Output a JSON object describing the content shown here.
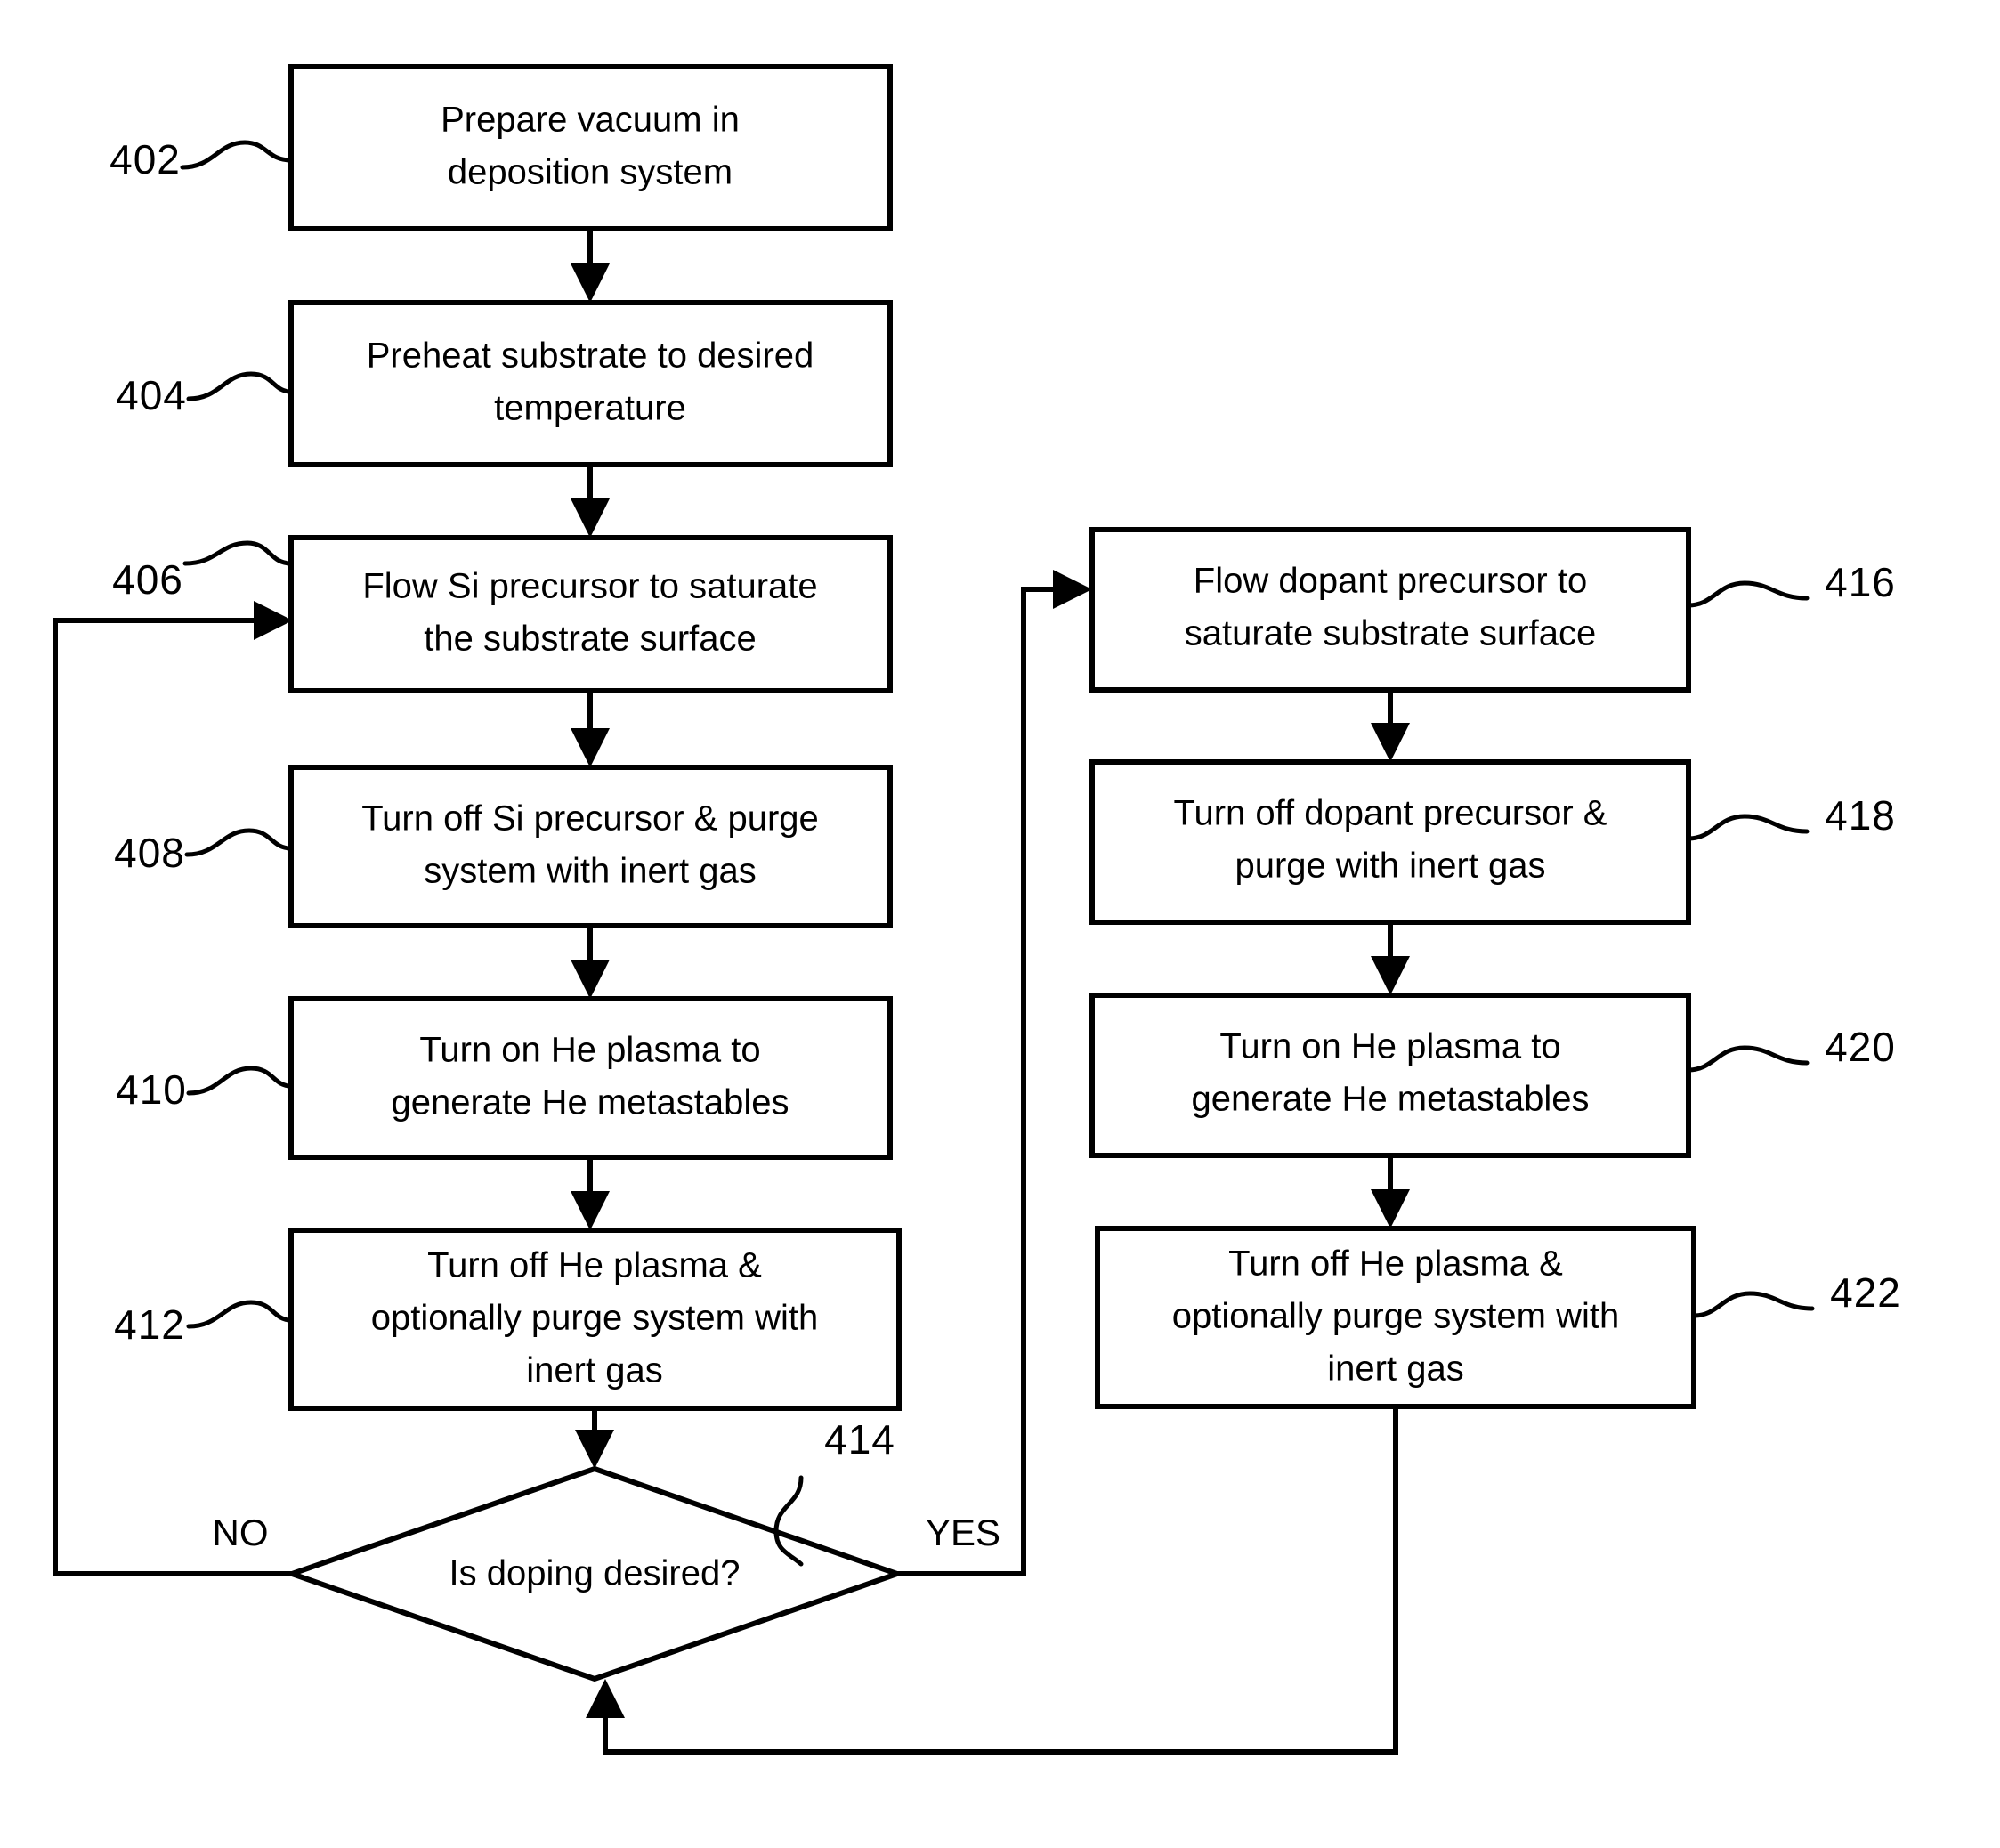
{
  "figure": {
    "type": "patent-flowchart",
    "boxes": [
      {
        "ref": "402",
        "lines": [
          "Prepare vacuum in",
          "deposition system"
        ]
      },
      {
        "ref": "404",
        "lines": [
          "Preheat substrate to desired",
          "temperature"
        ]
      },
      {
        "ref": "406",
        "lines": [
          "Flow Si precursor to saturate",
          "the substrate surface"
        ]
      },
      {
        "ref": "408",
        "lines": [
          "Turn off Si precursor & purge",
          "system with inert gas"
        ]
      },
      {
        "ref": "410",
        "lines": [
          "Turn on He plasma to",
          "generate He metastables"
        ]
      },
      {
        "ref": "412",
        "lines": [
          "Turn off He plasma &",
          "optionally purge system with",
          "inert gas"
        ]
      },
      {
        "ref": "416",
        "lines": [
          "Flow dopant precursor to",
          "saturate substrate surface"
        ]
      },
      {
        "ref": "418",
        "lines": [
          "Turn off dopant precursor &",
          "purge with inert gas"
        ]
      },
      {
        "ref": "420",
        "lines": [
          "Turn on He plasma to",
          "generate He metastables"
        ]
      },
      {
        "ref": "422",
        "lines": [
          "Turn off He plasma &",
          "optionally purge system with",
          "inert gas"
        ]
      }
    ],
    "decision": {
      "ref": "414",
      "label": "Is doping desired?",
      "branch_no": "NO",
      "branch_yes": "YES"
    },
    "colors": {
      "stroke": "#000000",
      "fill": "#ffffff"
    }
  }
}
